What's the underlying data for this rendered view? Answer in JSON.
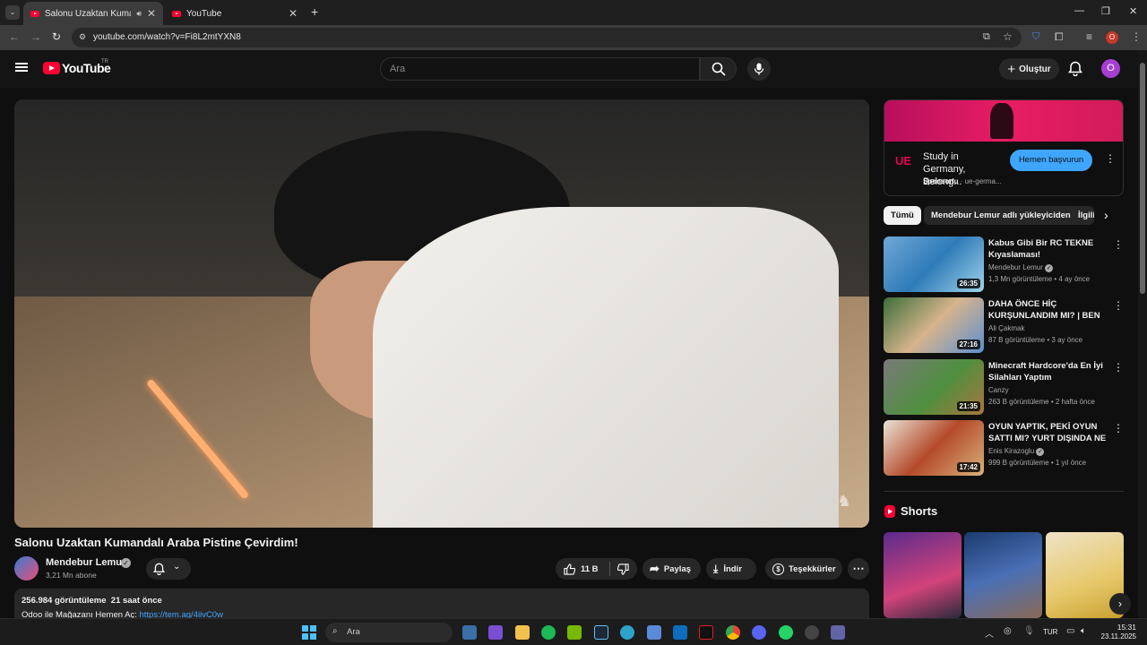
{
  "browser": {
    "tabs": [
      {
        "title": "Salonu Uzaktan Kumandalı",
        "active": true
      },
      {
        "title": "YouTube",
        "active": false
      }
    ],
    "url": "youtube.com/watch?v=Fi8L2mtYXN8",
    "profile_initial": "O"
  },
  "header": {
    "logo_text": "YouTube",
    "logo_region": "TR",
    "search_placeholder": "Ara",
    "create_label": "Oluştur",
    "avatar_initial": "O"
  },
  "video": {
    "title": "Salonu Uzaktan Kumandalı Araba Pistine Çevirdim!",
    "channel": "Mendebur Lemur",
    "subscribers": "3,21 Mn abone",
    "likes": "11 B",
    "share_label": "Paylaş",
    "download_label": "İndir",
    "thanks_label": "Teşekkürler",
    "views_age": "256.984 görüntüleme  21 saat önce",
    "description_line": "Odoo ile Mağazanı Hemen Aç: ",
    "description_link": "https://tem.ag/4iivC0w"
  },
  "ad": {
    "logo": "UE",
    "title": "Study in Germany, Belong...",
    "sponsored": "Sponsorlu",
    "domain": "· ue-germa...",
    "cta": "Hemen başvurun"
  },
  "chips": [
    "Tümü",
    "Mendebur Lemur adlı yükleyiciden",
    "İlgili"
  ],
  "recommendations": [
    {
      "title": "Kabus Gibi Bir RC TEKNE Kıyaslaması!",
      "channel": "Mendebur Lemur",
      "meta": "1,3 Mn görüntüleme • 4 ay önce",
      "duration": "26:35",
      "verified": true
    },
    {
      "title": "DAHA ÖNCE HİÇ KURŞUNLANDIM MI? | BEN ...",
      "channel": "Ali Çakmak",
      "meta": "87 B görüntüleme • 3 ay önce",
      "duration": "27:16",
      "verified": false
    },
    {
      "title": "Minecraft Hardcore'da En İyi Silahları Yaptım",
      "channel": "Canzy",
      "meta": "263 B görüntüleme • 2 hafta önce",
      "duration": "21:35",
      "verified": false
    },
    {
      "title": "OYUN YAPTIK, PEKİ OYUN SATTI MI? YURT DIŞINDA NE ...",
      "channel": "Enis Kirazoglu",
      "meta": "999 B görüntüleme • 1 yıl önce",
      "duration": "17:42",
      "verified": true
    }
  ],
  "shorts_label": "Shorts",
  "taskbar": {
    "search_label": "Ara",
    "lang": "TUR",
    "time": "15:31",
    "date": "23.11.2025"
  },
  "colors": {
    "accent_red": "#ff0033",
    "link_blue": "#3ea6ff",
    "avatar_purple": "#a63ed1"
  }
}
